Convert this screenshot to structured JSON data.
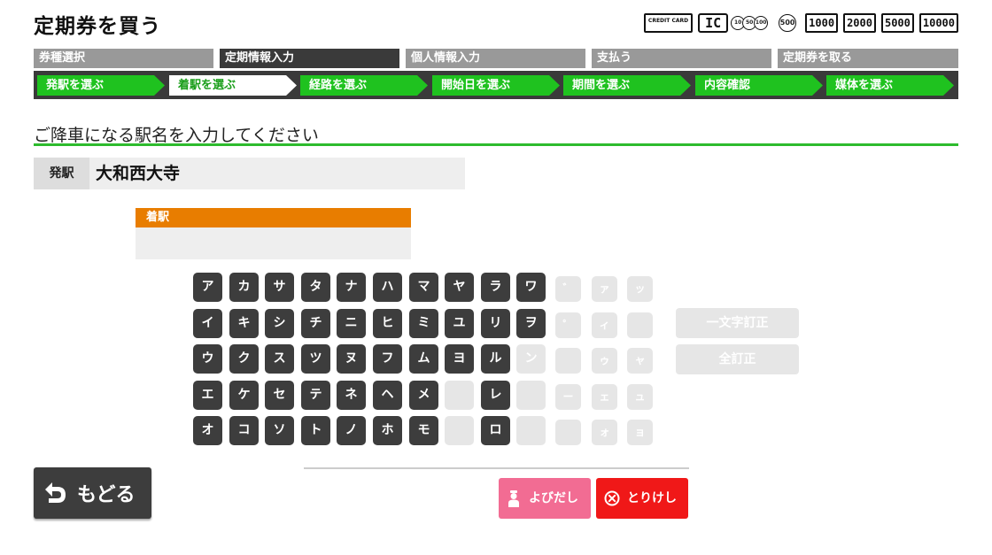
{
  "header": {
    "title": "定期券を買う",
    "payment": {
      "credit_card": "CREDIT CARD",
      "ic": "IC",
      "coins": [
        "10",
        "50",
        "100"
      ],
      "coin_500": "500",
      "bills": [
        "1000",
        "2000",
        "5000",
        "10000"
      ]
    }
  },
  "steps": [
    {
      "label": "券種選択",
      "state": "done"
    },
    {
      "label": "定期情報入力",
      "state": "active"
    },
    {
      "label": "個人情報入力",
      "state": "pending"
    },
    {
      "label": "支払う",
      "state": "pending"
    },
    {
      "label": "定期券を取る",
      "state": "pending"
    }
  ],
  "substeps": [
    {
      "label": "発駅を選ぶ"
    },
    {
      "label": "着駅を選ぶ",
      "current": true
    },
    {
      "label": "経路を選ぶ"
    },
    {
      "label": "開始日を選ぶ"
    },
    {
      "label": "期間を選ぶ"
    },
    {
      "label": "内容確認"
    },
    {
      "label": "媒体を選ぶ"
    }
  ],
  "prompt": "ご降車になる駅名を入力してください",
  "departure": {
    "label": "発駅",
    "value": "大和西大寺"
  },
  "arrival": {
    "label": "着駅",
    "value": ""
  },
  "keyboard": {
    "columns": [
      [
        "ア",
        "イ",
        "ウ",
        "エ",
        "オ"
      ],
      [
        "カ",
        "キ",
        "ク",
        "ケ",
        "コ"
      ],
      [
        "サ",
        "シ",
        "ス",
        "セ",
        "ソ"
      ],
      [
        "タ",
        "チ",
        "ツ",
        "テ",
        "ト"
      ],
      [
        "ナ",
        "ニ",
        "ヌ",
        "ネ",
        "ノ"
      ],
      [
        "ハ",
        "ヒ",
        "フ",
        "ヘ",
        "ホ"
      ],
      [
        "マ",
        "ミ",
        "ム",
        "メ",
        "モ"
      ],
      [
        "ヤ",
        "ユ",
        "ヨ",
        "",
        ""
      ],
      [
        "ラ",
        "リ",
        "ル",
        "レ",
        "ロ"
      ],
      [
        "ワ",
        "ヲ",
        "ン",
        "",
        ""
      ]
    ],
    "disabled_keys": [
      "ン"
    ],
    "small_columns": [
      [
        "゛",
        "゜",
        "",
        "ー",
        ""
      ],
      [
        "ァ",
        "ィ",
        "ゥ",
        "ェ",
        "ォ"
      ],
      [
        "ッ",
        "",
        "ャ",
        "ュ",
        "ョ"
      ]
    ],
    "backspace": "一文字訂正",
    "clear": "全訂正"
  },
  "buttons": {
    "back": "もどる",
    "call": "よびだし",
    "cancel": "とりけし"
  },
  "colors": {
    "accent_green": "#1fc21f",
    "arrival_orange": "#e87d00",
    "call_pink": "#f26c93",
    "cancel_red": "#f01818",
    "dark_key": "#3d3d3d"
  }
}
